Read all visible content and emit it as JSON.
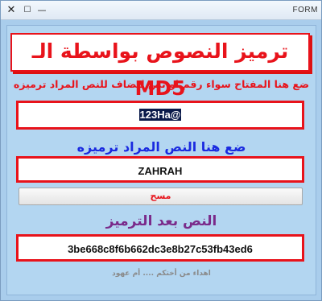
{
  "window": {
    "title": "FORM",
    "controls": {
      "close": "✕",
      "maximize": "☐",
      "minimize": "—"
    }
  },
  "heading": {
    "prefix": "ترميز النصوص بواسطة الـ ",
    "md5": "MD5"
  },
  "key_section": {
    "label": "ضع هنا المفتاح سواء رقم او نص ليضاف للنص المراد ترميزه",
    "value": "123Ha@"
  },
  "text_section": {
    "label": "ضع هنا النص المراد ترميزه",
    "value": "ZAHRAH"
  },
  "clear_button": {
    "label": "مسح"
  },
  "result_section": {
    "label": "النص بعد الترميز",
    "value": "3be668c8f6b662dc3e8b27c53fb43ed6"
  },
  "dedication": "اهداء من أختكم .... أم عهود",
  "colors": {
    "background": "#a9cdec",
    "accent_red": "#e8131b",
    "label_blue": "#1a2ae0",
    "label_purple": "#7a2a8a"
  }
}
